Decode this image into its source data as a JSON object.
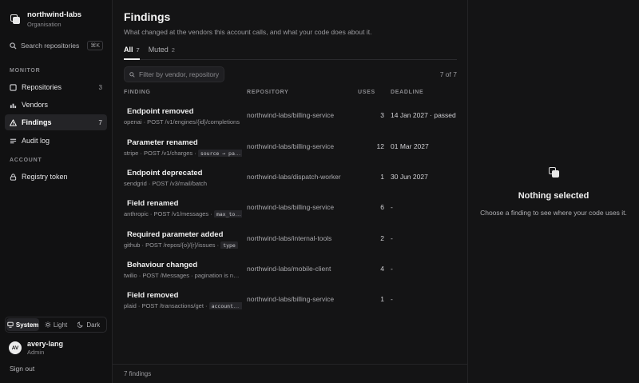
{
  "org": {
    "name": "northwind-labs",
    "type": "Organisation"
  },
  "search": {
    "label": "Search repositories",
    "shortcut": "⌘K"
  },
  "sections": {
    "monitor": "MONITOR",
    "account": "ACCOUNT"
  },
  "nav": {
    "repositories": {
      "label": "Repositories",
      "count": "3"
    },
    "vendors": {
      "label": "Vendors"
    },
    "findings": {
      "label": "Findings",
      "count": "7"
    },
    "audit_log": {
      "label": "Audit log"
    },
    "registry_token": {
      "label": "Registry token"
    }
  },
  "theme": {
    "system": "System",
    "light": "Light",
    "dark": "Dark",
    "selected": "System"
  },
  "user": {
    "initials": "AV",
    "name": "avery-lang",
    "role": "Admin"
  },
  "signout": "Sign out",
  "page": {
    "title": "Findings",
    "subtitle": "What changed at the vendors this account calls, and what your code does about it."
  },
  "tabs": [
    {
      "label": "All",
      "count": "7",
      "active": true
    },
    {
      "label": "Muted",
      "count": "2",
      "active": false
    }
  ],
  "filter": {
    "placeholder": "Filter by vendor, repository",
    "value": ""
  },
  "pager": "7 of 7",
  "columns": {
    "finding": "FINDING",
    "repository": "REPOSITORY",
    "uses": "USES",
    "deadline": "DEADLINE"
  },
  "findings": [
    {
      "title": "Endpoint removed",
      "meta": "openai · POST /v1/engines/{id}/completions",
      "code": "",
      "repo": "northwind-labs/billing-service",
      "uses": "3",
      "deadline": "14 Jan 2027 · passed"
    },
    {
      "title": "Parameter renamed",
      "meta": "stripe · POST /v1/charges ·",
      "code": "source → payment_method",
      "repo": "northwind-labs/billing-service",
      "uses": "12",
      "deadline": "01 Mar 2027"
    },
    {
      "title": "Endpoint deprecated",
      "meta": "sendgrid · POST /v3/mail/batch",
      "code": "",
      "repo": "northwind-labs/dispatch-worker",
      "uses": "1",
      "deadline": "30 Jun 2027"
    },
    {
      "title": "Field renamed",
      "meta": "anthropic · POST /v1/messages ·",
      "code": "max_tokens_to_sample",
      "repo": "northwind-labs/billing-service",
      "uses": "6",
      "deadline": "-"
    },
    {
      "title": "Required parameter added",
      "meta": "github · POST /repos/{o}/{r}/issues ·",
      "code": "type",
      "repo": "northwind-labs/internal-tools",
      "uses": "2",
      "deadline": "-"
    },
    {
      "title": "Behaviour changed",
      "meta": "twilio · POST /Messages · pagination is now cursor-based",
      "code": "",
      "repo": "northwind-labs/mobile-client",
      "uses": "4",
      "deadline": "-"
    },
    {
      "title": "Field removed",
      "meta": "plaid · POST /transactions/get ·",
      "code": "account_owner",
      "repo": "northwind-labs/billing-service",
      "uses": "1",
      "deadline": "-"
    }
  ],
  "footer": "7 findings",
  "detail": {
    "title": "Nothing selected",
    "subtitle": "Choose a finding to see where your code uses it."
  },
  "icons": {
    "org": "stacked-squares-icon",
    "search": "search-icon",
    "repositories": "square-icon",
    "vendors": "bar-chart-icon",
    "findings": "warning-triangle-icon",
    "audit_log": "lines-icon",
    "registry_token": "lock-icon",
    "system": "monitor-icon",
    "light": "sun-icon",
    "dark": "moon-icon"
  }
}
